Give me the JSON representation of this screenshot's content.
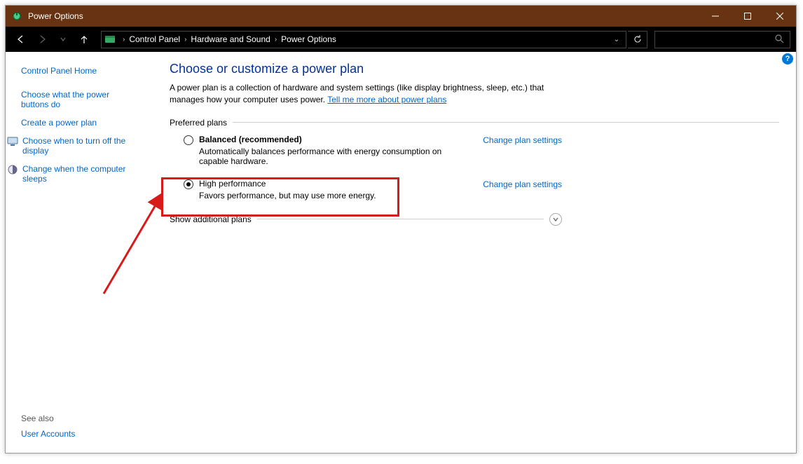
{
  "window": {
    "title": "Power Options"
  },
  "breadcrumb": {
    "segments": [
      "Control Panel",
      "Hardware and Sound",
      "Power Options"
    ]
  },
  "sidebar": {
    "home": "Control Panel Home",
    "links": [
      "Choose what the power buttons do",
      "Create a power plan",
      "Choose when to turn off the display",
      "Change when the computer sleeps"
    ],
    "see_also_label": "See also",
    "see_also_links": [
      "User Accounts"
    ]
  },
  "main": {
    "heading": "Choose or customize a power plan",
    "description": "A power plan is a collection of hardware and system settings (like display brightness, sleep, etc.) that manages how your computer uses power. ",
    "more_link": "Tell me more about power plans",
    "preferred_label": "Preferred plans",
    "plans": [
      {
        "name": "Balanced (recommended)",
        "desc": "Automatically balances performance with energy consumption on capable hardware.",
        "selected": false,
        "settings": "Change plan settings"
      },
      {
        "name": "High performance",
        "desc": "Favors performance, but may use more energy.",
        "selected": true,
        "settings": "Change plan settings"
      }
    ],
    "show_additional": "Show additional plans"
  },
  "help_tooltip": "?"
}
